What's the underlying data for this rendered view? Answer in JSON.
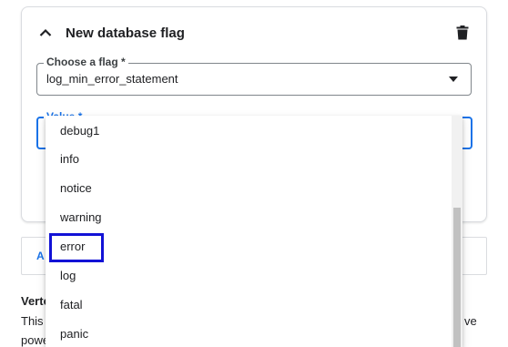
{
  "card": {
    "title": "New database flag",
    "collapse_icon": "chevron-up-icon",
    "delete_icon": "trash-icon"
  },
  "flag_field": {
    "label": "Choose a flag *",
    "value": "log_min_error_statement"
  },
  "value_field": {
    "label": "Value *"
  },
  "dropdown": {
    "options": [
      "debug1",
      "info",
      "notice",
      "warning",
      "error",
      "log",
      "fatal",
      "panic"
    ],
    "highlighted": "error"
  },
  "background": {
    "tab_text": "A",
    "heading": "Verte",
    "line1": "This",
    "line2": "powe",
    "line1_tail": "ve"
  },
  "colors": {
    "accent": "#1a73e8",
    "highlight": "#1212d6"
  }
}
